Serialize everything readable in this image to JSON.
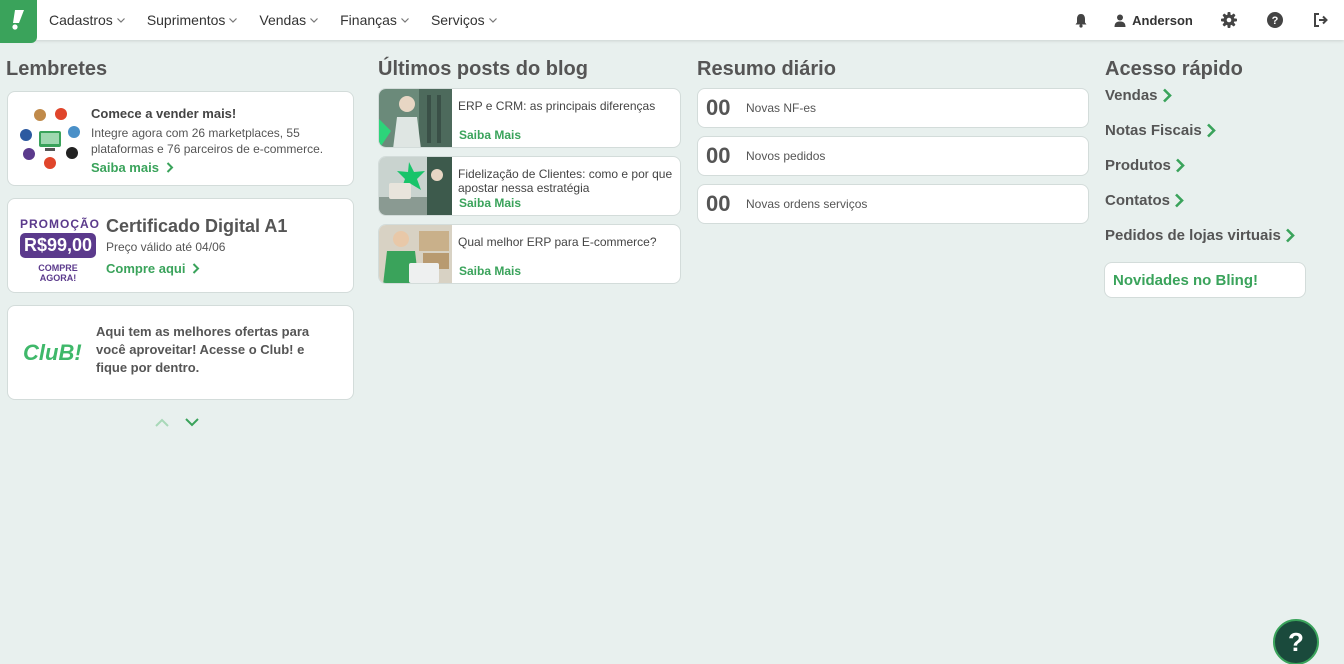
{
  "nav": {
    "items": [
      {
        "label": "Cadastros"
      },
      {
        "label": "Suprimentos"
      },
      {
        "label": "Vendas"
      },
      {
        "label": "Finanças"
      },
      {
        "label": "Serviços"
      }
    ],
    "user_name": "Anderson",
    "icons": [
      "bell-icon",
      "user-icon",
      "gear-icon",
      "help-icon",
      "logout-icon"
    ]
  },
  "reminders": {
    "title": "Lembretes",
    "card1": {
      "heading": "Comece a vender mais!",
      "body": "Integre agora com 26 marketplaces, 55 plataformas e 76 parceiros de e-commerce.",
      "link": "Saiba mais"
    },
    "card2": {
      "promo_label": "PROMOÇÃO",
      "price": "R$99,00",
      "buy_now": "COMPRE AGORA!",
      "heading": "Certificado Digital A1",
      "sub": "Preço válido até 04/06",
      "link": "Compre aqui"
    },
    "card3": {
      "logo_text": "CluB!",
      "body": "Aqui tem as melhores ofertas para você aproveitar! Acesse o Club! e fique por dentro."
    }
  },
  "blog": {
    "title": "Últimos posts do blog",
    "posts": [
      {
        "title": "ERP e CRM: as principais diferenças",
        "link": "Saiba Mais"
      },
      {
        "title": "Fidelização de Clientes: como e por que apostar nessa estratégia",
        "link": "Saiba Mais"
      },
      {
        "title": "Qual melhor ERP para E-commerce?",
        "link": "Saiba Mais"
      }
    ]
  },
  "summary": {
    "title": "Resumo diário",
    "items": [
      {
        "count": "00",
        "label": "Novas NF-es"
      },
      {
        "count": "00",
        "label": "Novos pedidos"
      },
      {
        "count": "00",
        "label": "Novas ordens serviços"
      }
    ]
  },
  "quick_access": {
    "title": "Acesso rápido",
    "links": [
      {
        "label": "Vendas"
      },
      {
        "label": "Notas Fiscais"
      },
      {
        "label": "Produtos"
      },
      {
        "label": "Contatos"
      },
      {
        "label": "Pedidos de lojas virtuais"
      }
    ],
    "news_button": "Novidades no Bling!"
  },
  "help_fab": "?",
  "colors": {
    "accent": "#3aa35b",
    "dark_green": "#1a4a3c",
    "purple": "#5b3a8c",
    "background": "#e8f0ee"
  }
}
